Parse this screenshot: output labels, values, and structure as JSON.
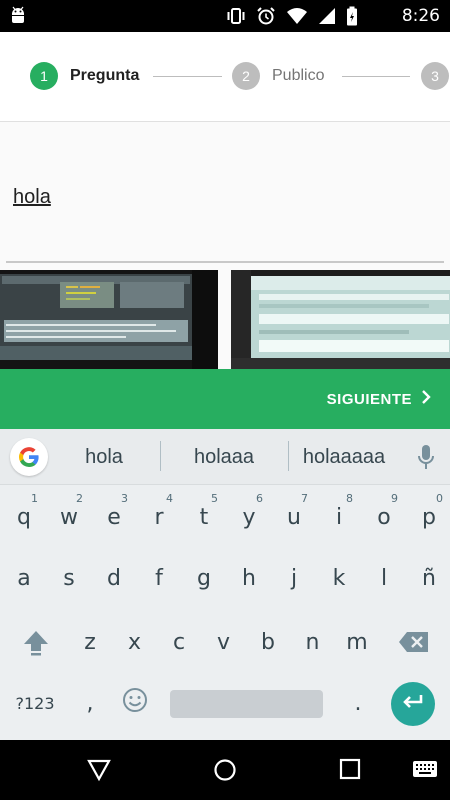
{
  "status_bar": {
    "time": "8:26",
    "icons": [
      "android-icon",
      "vibrate-icon",
      "alarm-icon",
      "wifi-icon",
      "signal-icon",
      "battery-icon"
    ]
  },
  "stepper": {
    "steps": [
      {
        "number": "1",
        "label": "Pregunta",
        "active": true
      },
      {
        "number": "2",
        "label": "Publico",
        "active": false
      },
      {
        "number": "3",
        "label": "",
        "active": false
      }
    ],
    "active_color": "#27ae60",
    "inactive_color": "#bdbdbd"
  },
  "question": {
    "value": "hola"
  },
  "actions": {
    "next_label": "SIGUIENTE",
    "accent": "#27ae60"
  },
  "keyboard": {
    "suggestions": [
      "hola",
      "holaaa",
      "holaaaaa"
    ],
    "row1": [
      {
        "k": "q",
        "h": "1"
      },
      {
        "k": "w",
        "h": "2"
      },
      {
        "k": "e",
        "h": "3"
      },
      {
        "k": "r",
        "h": "4"
      },
      {
        "k": "t",
        "h": "5"
      },
      {
        "k": "y",
        "h": "6"
      },
      {
        "k": "u",
        "h": "7"
      },
      {
        "k": "i",
        "h": "8"
      },
      {
        "k": "o",
        "h": "9"
      },
      {
        "k": "p",
        "h": "0"
      }
    ],
    "row2": [
      "a",
      "s",
      "d",
      "f",
      "g",
      "h",
      "j",
      "k",
      "l",
      "ñ"
    ],
    "row3": [
      "z",
      "x",
      "c",
      "v",
      "b",
      "n",
      "m"
    ],
    "symbols_label": "?123",
    "comma": ",",
    "period": "."
  }
}
